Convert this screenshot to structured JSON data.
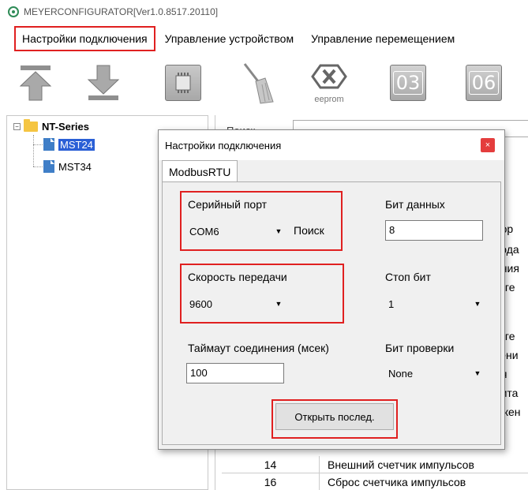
{
  "window": {
    "title": "MEYERCONFIGURATOR[Ver1.0.8517.20110]"
  },
  "menu": {
    "items": [
      "Настройки подключения",
      "Управление устройством",
      "Управление перемещением"
    ]
  },
  "toolbar": {
    "icons": [
      "upload-arrow-icon",
      "download-arrow-icon",
      "chip-icon",
      "broom-icon",
      "eeprom-clear-icon",
      "function-03-icon",
      "function-06-icon"
    ],
    "eeprom_label": "eeprom",
    "func_03": "03",
    "func_06": "06"
  },
  "tree": {
    "root": "NT-Series",
    "children": [
      "MST24",
      "MST34"
    ],
    "selected": "MST24"
  },
  "background_panel": {
    "label": "Поиск",
    "fragments": [
      "пор",
      "вода",
      "ения",
      "игге",
      "игге",
      "тени",
      "ия",
      "пита",
      "ожен"
    ],
    "rows": [
      {
        "num": "14",
        "text": "Внешний счетчик импульсов"
      },
      {
        "num": "16",
        "text": "Сброс счетчика импульсов"
      },
      {
        "num": "17",
        "text": ""
      }
    ]
  },
  "dialog": {
    "title": "Настройки подключения",
    "close": "×",
    "tab": "ModbusRTU",
    "serial_port": {
      "label": "Серийный порт",
      "value": "COM6",
      "search": "Поиск"
    },
    "baud_rate": {
      "label": "Скорость передачи",
      "value": "9600"
    },
    "timeout": {
      "label": "Таймаут соединения (мсек)",
      "value": "100"
    },
    "data_bits": {
      "label": "Бит данных",
      "value": "8"
    },
    "stop_bits": {
      "label": "Стоп бит",
      "value": "1"
    },
    "parity": {
      "label": "Бит проверки",
      "value": "None"
    },
    "open_button": "Открыть послед."
  },
  "colors": {
    "highlight": "#e02020",
    "selection": "#2a5fd6",
    "close": "#e43d3d"
  }
}
